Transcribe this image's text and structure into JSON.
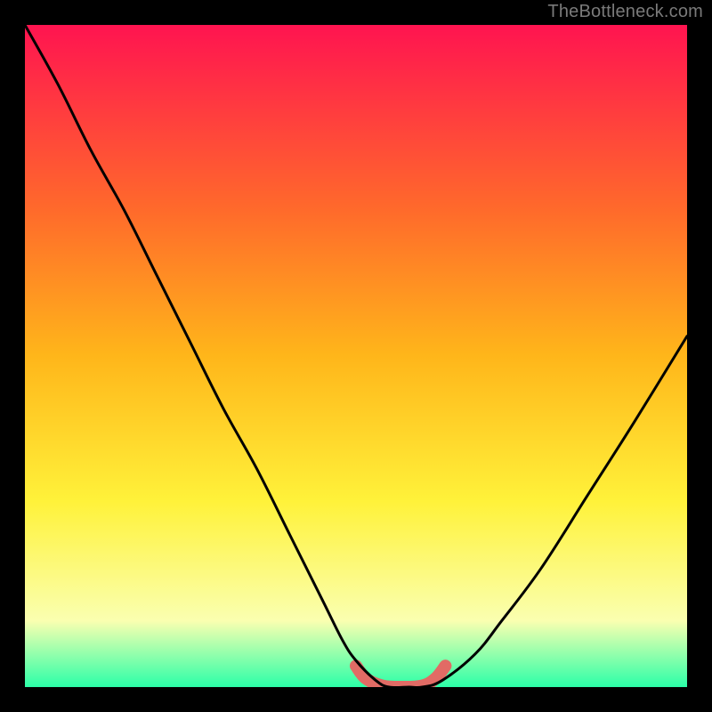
{
  "watermark": "TheBottleneck.com",
  "colors": {
    "gradient_top": "#ff1450",
    "gradient_mid_upper": "#ff6a2b",
    "gradient_mid": "#ffb61a",
    "gradient_mid_lower": "#fff23a",
    "gradient_low": "#faffb0",
    "gradient_bottom": "#2bffa8",
    "curve": "#000000",
    "highlight": "#e16b65",
    "frame": "#000000"
  },
  "chart_data": {
    "type": "line",
    "title": "",
    "xlabel": "",
    "ylabel": "",
    "xlim": [
      0,
      100
    ],
    "ylim": [
      0,
      100
    ],
    "series": [
      {
        "name": "bottleneck-curve",
        "x": [
          0,
          5,
          10,
          15,
          20,
          25,
          30,
          35,
          40,
          45,
          48,
          50,
          53,
          55,
          58,
          60,
          63,
          68,
          72,
          78,
          85,
          92,
          100
        ],
        "y": [
          100,
          91,
          81,
          72,
          62,
          52,
          42,
          33,
          23,
          13,
          7,
          4,
          1,
          0,
          0,
          0,
          1,
          5,
          10,
          18,
          29,
          40,
          53
        ]
      },
      {
        "name": "optimal-range-highlight",
        "x": [
          50,
          51.5,
          54,
          57,
          60,
          62,
          63.5
        ],
        "y": [
          3.2,
          1.3,
          0.2,
          0,
          0.2,
          1.3,
          3.2
        ]
      }
    ],
    "optimal_x_range": [
      50,
      63.5
    ]
  }
}
